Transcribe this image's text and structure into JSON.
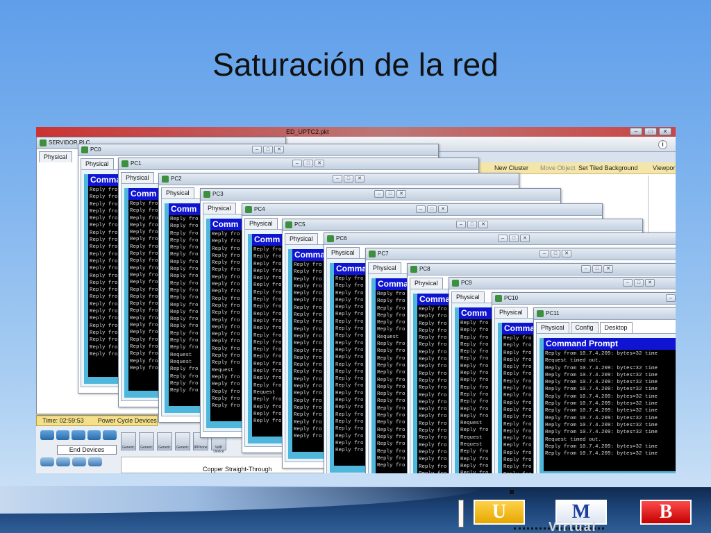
{
  "slide": {
    "title": "Saturación de la red"
  },
  "pt": {
    "file_title": "ED_UPTC2.pkt",
    "servidor_title": "SERVIDOR PLC",
    "toolbar": {
      "new_cluster": "New Cluster",
      "move_object": "Move Object",
      "set_tiled": "Set Tiled Background",
      "viewport": "Viewpor"
    },
    "info_icon": "i",
    "status": {
      "time": "Time: 02:59:53",
      "power_cycle": "Power Cycle Devices"
    },
    "device_category": "End Devices",
    "cable": "Copper Straight-Through",
    "generic_devices": [
      "Generic",
      "Generic",
      "Generic",
      "Generic",
      "IPPhone",
      "VoIP Device"
    ]
  },
  "windows": [
    {
      "name": "PC0",
      "tab": "Physical",
      "cmd": "Comma"
    },
    {
      "name": "PC1",
      "tab": "Physical",
      "cmd": "Comm"
    },
    {
      "name": "PC2",
      "tab": "Physical",
      "cmd": "Comm"
    },
    {
      "name": "PC3",
      "tab": "Physical",
      "cmd": "Comm"
    },
    {
      "name": "PC4",
      "tab": "Physical",
      "cmd": "Comm"
    },
    {
      "name": "PC5",
      "tab": "Physical",
      "cmd": "Comma"
    },
    {
      "name": "PC6",
      "tab": "Physical",
      "cmd": "Comma"
    },
    {
      "name": "PC7",
      "tab": "Physical",
      "cmd": "Comma"
    },
    {
      "name": "PC8",
      "tab": "Physical",
      "cmd": "Comma"
    },
    {
      "name": "PC9",
      "tab": "Physical",
      "cmd": "Comm"
    },
    {
      "name": "PC10",
      "tab": "Physical",
      "cmd": "Comma"
    },
    {
      "name": "PC11",
      "tabs": [
        "Physical",
        "Config",
        "Desktop"
      ],
      "cmd": "Command Prompt"
    }
  ],
  "pc11_lines": [
    "Reply from 10.7.4.209: bytes=32 time",
    "Request timed out.",
    "Reply from 10.7.4.209: bytes=32 time",
    "Reply from 10.7.4.209: bytes=32 time",
    "Reply from 10.7.4.209: bytes=32 time",
    "Reply from 10.7.4.209: bytes=32 time",
    "Reply from 10.7.4.209: bytes=32 time",
    "Reply from 10.7.4.209: bytes=32 time",
    "Reply from 10.7.4.209: bytes=32 time",
    "Reply from 10.7.4.209: bytes=32 time",
    "Reply from 10.7.4.209: bytes=32 time",
    "Reply from 10.7.4.209: bytes=32 time",
    "Request timed out.",
    "Reply from 10.7.4.209: bytes=32 time",
    "Reply from 10.7.4.209: bytes=32 time"
  ],
  "short_lines": {
    "reply": "Reply fro",
    "request": "Request"
  },
  "logo": {
    "u": "U",
    "m": "M",
    "b": "B",
    "virtual": "Virtual"
  },
  "colors": {
    "cmd_header": "#0f14d2",
    "cmd_bg": "#000000",
    "cyan": "#4fb6dc",
    "pt_red": "#c33333"
  }
}
